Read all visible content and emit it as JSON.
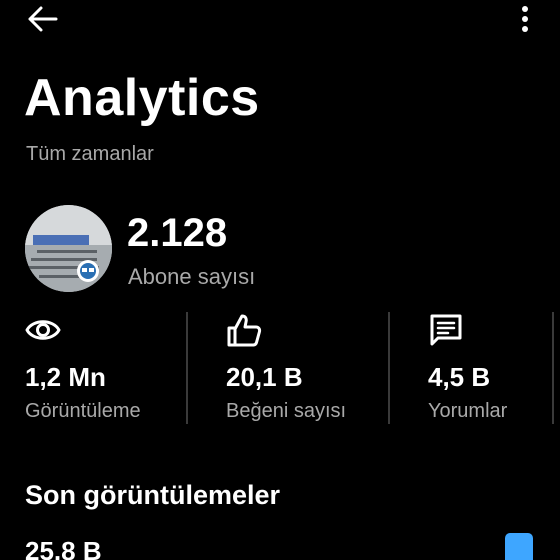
{
  "header": {
    "back_icon": "arrow-left-icon",
    "more_icon": "more-vertical-icon"
  },
  "title": "Analytics",
  "subtitle": "Tüm zamanlar",
  "channel": {
    "subscriber_count": "2.128",
    "subscriber_label": "Abone sayısı"
  },
  "stats": [
    {
      "icon": "eye-icon",
      "value": "1,2 Mn",
      "label": "Görüntüleme"
    },
    {
      "icon": "thumbs-up-icon",
      "value": "20,1 B",
      "label": "Beğeni sayısı"
    },
    {
      "icon": "comment-icon",
      "value": "4,5 B",
      "label": "Yorumlar"
    }
  ],
  "recent": {
    "title": "Son görüntülemeler",
    "value": "25,8 B"
  },
  "colors": {
    "background": "#000000",
    "text": "#ffffff",
    "secondary_text": "#a9a9a9",
    "divider": "#3a3a3a",
    "accent": "#3ea6ff"
  }
}
